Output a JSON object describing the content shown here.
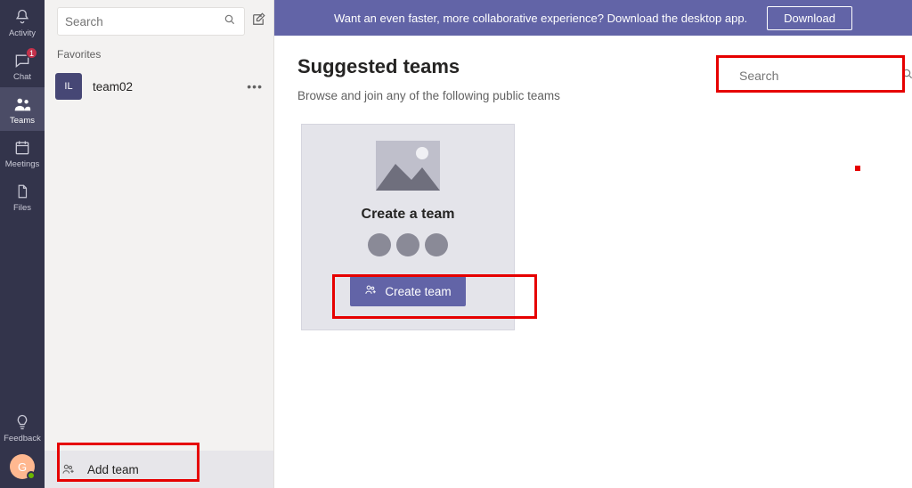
{
  "rail": {
    "items": [
      {
        "label": "Activity"
      },
      {
        "label": "Chat",
        "badge": "1"
      },
      {
        "label": "Teams"
      },
      {
        "label": "Meetings"
      },
      {
        "label": "Files"
      }
    ],
    "feedback": "Feedback",
    "avatar_initial": "G"
  },
  "sidebar": {
    "search_placeholder": "Search",
    "favorites_label": "Favorites",
    "teams": [
      {
        "initials": "IL",
        "name": "team02"
      }
    ],
    "add_team": "Add team"
  },
  "banner": {
    "text": "Want an even faster, more collaborative experience? Download the desktop app.",
    "button": "Download"
  },
  "page": {
    "title": "Suggested teams",
    "subtitle": "Browse and join any of the following public teams",
    "card_title": "Create a team",
    "create_button": "Create team",
    "right_search_placeholder": "Search"
  }
}
